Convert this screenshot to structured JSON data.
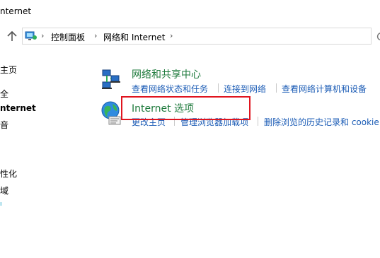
{
  "window": {
    "title": "nternet"
  },
  "address": {
    "crumbs": [
      "控制面板",
      "网络和 Internet"
    ],
    "separator": "›"
  },
  "sidebar": {
    "items": [
      "主页",
      "全",
      "nternet",
      "音",
      "性化",
      "域"
    ]
  },
  "sections": {
    "network_center": {
      "title": "网络和共享中心",
      "links": [
        "查看网络状态和任务",
        "连接到网络",
        "查看网络计算机和设备"
      ]
    },
    "internet_options": {
      "title": "Internet 选项",
      "links": [
        "更改主页",
        "管理浏览器加载项",
        "删除浏览的历史记录和 cookie"
      ]
    }
  },
  "colors": {
    "link": "#1a5bb5",
    "section_title": "#1e7a3c",
    "highlight": "#e0141e"
  }
}
